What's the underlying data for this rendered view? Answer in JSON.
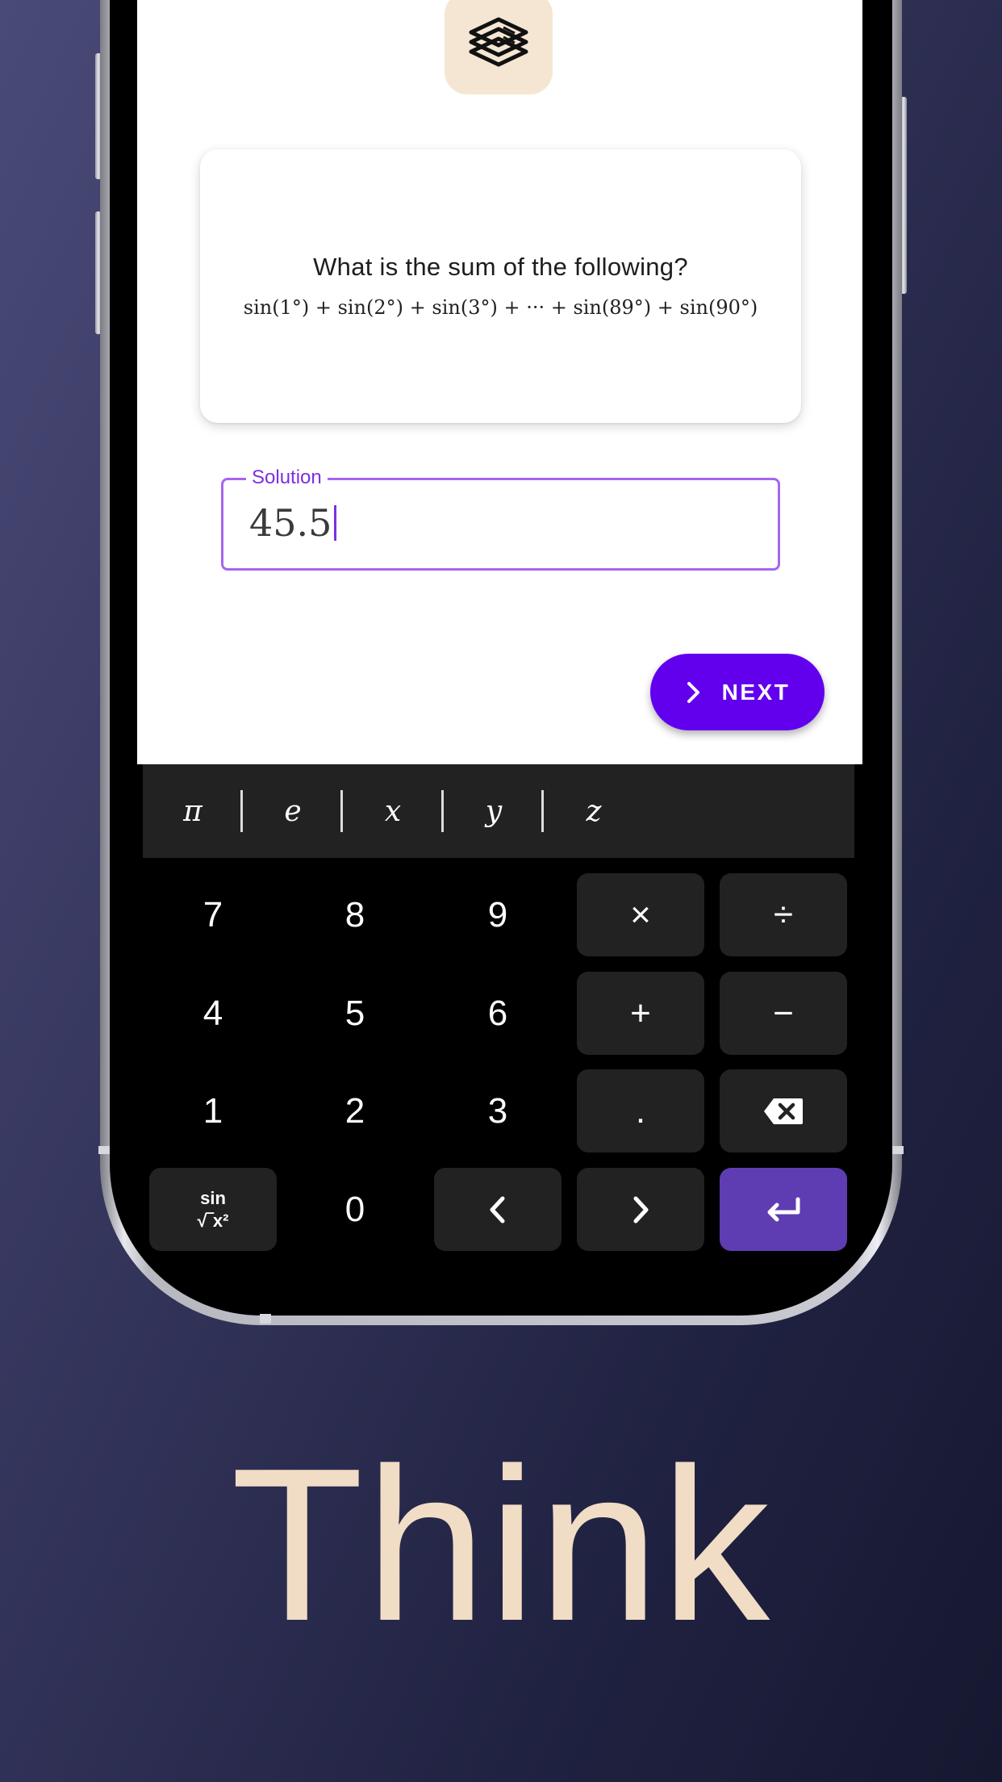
{
  "question": {
    "title": "What is the sum of the following?",
    "formula": "sin(1°) + sin(2°) + sin(3°) + ··· + sin(89°) + sin(90°)"
  },
  "solution": {
    "label": "Solution",
    "value": "45.5"
  },
  "next_button": {
    "label": "NEXT",
    "icon": "chevron-right-icon"
  },
  "variables": [
    "π",
    "e",
    "x",
    "y",
    "z"
  ],
  "keypad": {
    "k7": "7",
    "k8": "8",
    "k9": "9",
    "mul": "×",
    "div": "÷",
    "k4": "4",
    "k5": "5",
    "k6": "6",
    "add": "+",
    "sub": "−",
    "k1": "1",
    "k2": "2",
    "k3": "3",
    "dot": ".",
    "backspace_icon": "backspace-icon",
    "fn_line1": "sin",
    "fn_line2": "√‾x²",
    "k0": "0",
    "left_icon": "chevron-left-icon",
    "right_icon": "chevron-right-icon",
    "enter_icon": "enter-icon"
  },
  "headline": "Think",
  "colors": {
    "accent": "#6200ee",
    "enter_key": "#5e3db3",
    "icon_bg": "#f5e6d3",
    "headline": "#f1dcc5"
  }
}
